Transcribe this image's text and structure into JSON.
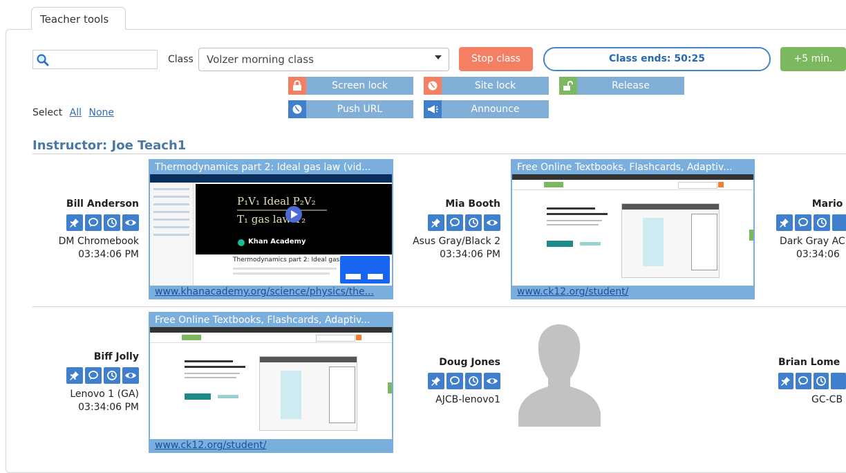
{
  "tab": {
    "label": "Teacher tools"
  },
  "search": {
    "placeholder": ""
  },
  "class_picker": {
    "label": "Class",
    "selected": "Volzer morning class"
  },
  "buttons": {
    "stop_class": "Stop class",
    "class_ends": "Class ends: 50:25",
    "plus5": "+5 min."
  },
  "actions": {
    "screen_lock": "Screen lock",
    "site_lock": "Site lock",
    "release": "Release",
    "push_url": "Push URL",
    "announce": "Announce"
  },
  "select": {
    "label": "Select",
    "all": "All",
    "none": "None"
  },
  "instructor": {
    "label": "Instructor: Joe Teach1"
  },
  "students": [
    {
      "name": "Bill Anderson",
      "device": "DM Chromebook",
      "time": "03:34:06 PM"
    },
    {
      "name": "Mia Booth",
      "device": "Asus Gray/Black 2",
      "time": "03:34:06 PM"
    },
    {
      "name": "Mario Gom",
      "device": "Dark Gray AC",
      "time": "03:34:06"
    },
    {
      "name": "Biff Jolly",
      "device": "Lenovo 1 (GA)",
      "time": "03:34:06 PM"
    },
    {
      "name": "Doug Jones",
      "device": "AJCB-lenovo1",
      "time": ""
    },
    {
      "name": "Brian Lome",
      "device": "GC-CB",
      "time": ""
    }
  ],
  "screens": [
    {
      "title": "Thermodynamics part 2: Ideal gas law (vid...",
      "url": "www.khanacademy.org/science/physics/the..."
    },
    {
      "title": "Free Online Textbooks, Flashcards, Adaptiv...",
      "url": "www.ck12.org/student/"
    },
    {
      "title": "Free Online Textbooks, Flashcards, Adaptiv...",
      "url": "www.ck12.org/student/"
    }
  ],
  "khan": {
    "brand": "Khan Academy",
    "video_title": "Thermodynamics part 2: Ideal gas law"
  },
  "colors": {
    "accent": "#3f7fcc",
    "stop": "#f47f63",
    "plus": "#7cb85f",
    "action": "#82afd8",
    "heading": "#4a78a4"
  }
}
